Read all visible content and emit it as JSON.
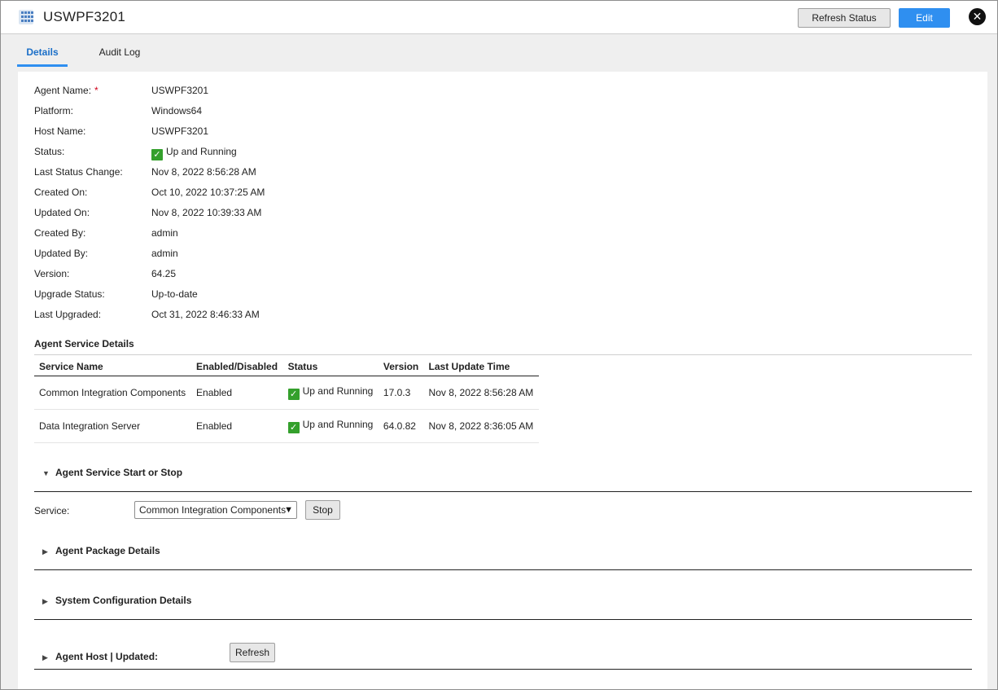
{
  "window": {
    "title": "USWPF3201"
  },
  "header": {
    "app_icon": "grid-app-icon",
    "refresh_status_label": "Refresh Status",
    "edit_label": "Edit",
    "close_icon": "close-icon"
  },
  "tabs": [
    {
      "label": "Details",
      "active": true
    },
    {
      "label": "Audit Log",
      "active": false
    }
  ],
  "details": {
    "agent_name_label": "Agent Name:",
    "agent_name_required": "*",
    "agent_name": "USWPF3201",
    "platform_label": "Platform:",
    "platform": "Windows64",
    "host_name_label": "Host Name:",
    "host_name": "USWPF3201",
    "status_label": "Status:",
    "status": "Up and Running",
    "last_status_change_label": "Last Status Change:",
    "last_status_change": "Nov 8, 2022 8:56:28 AM",
    "created_on_label": "Created On:",
    "created_on": "Oct 10, 2022 10:37:25 AM",
    "updated_on_label": "Updated On:",
    "updated_on": "Nov 8, 2022 10:39:33 AM",
    "created_by_label": "Created By:",
    "created_by": "admin",
    "updated_by_label": "Updated By:",
    "updated_by": "admin",
    "version_label": "Version:",
    "version": "64.25",
    "upgrade_status_label": "Upgrade Status:",
    "upgrade_status": "Up-to-date",
    "last_upgraded_label": "Last Upgraded:",
    "last_upgraded": "Oct 31, 2022 8:46:33 AM"
  },
  "service_details": {
    "title": "Agent Service Details",
    "columns": [
      "Service Name",
      "Enabled/Disabled",
      "Status",
      "Version",
      "Last Update Time"
    ],
    "rows": [
      {
        "name": "Common Integration Components",
        "enabled": "Enabled",
        "status": "Up and Running",
        "version": "17.0.3",
        "updated": "Nov 8, 2022 8:56:28 AM"
      },
      {
        "name": "Data Integration Server",
        "enabled": "Enabled",
        "status": "Up and Running",
        "version": "64.0.82",
        "updated": "Nov 8, 2022 8:36:05 AM"
      }
    ]
  },
  "start_stop": {
    "title": "Agent Service Start or Stop",
    "service_label": "Service:",
    "service_selected": "Common Integration Components",
    "stop_label": "Stop"
  },
  "package_details": {
    "title": "Agent Package Details"
  },
  "system_config": {
    "title": "System Configuration Details"
  },
  "agent_host": {
    "title": "Agent Host | Updated:",
    "refresh_label": "Refresh"
  },
  "colors": {
    "accent": "#2f8ff0",
    "status_ok": "#34a02c",
    "required": "#d0021b"
  }
}
